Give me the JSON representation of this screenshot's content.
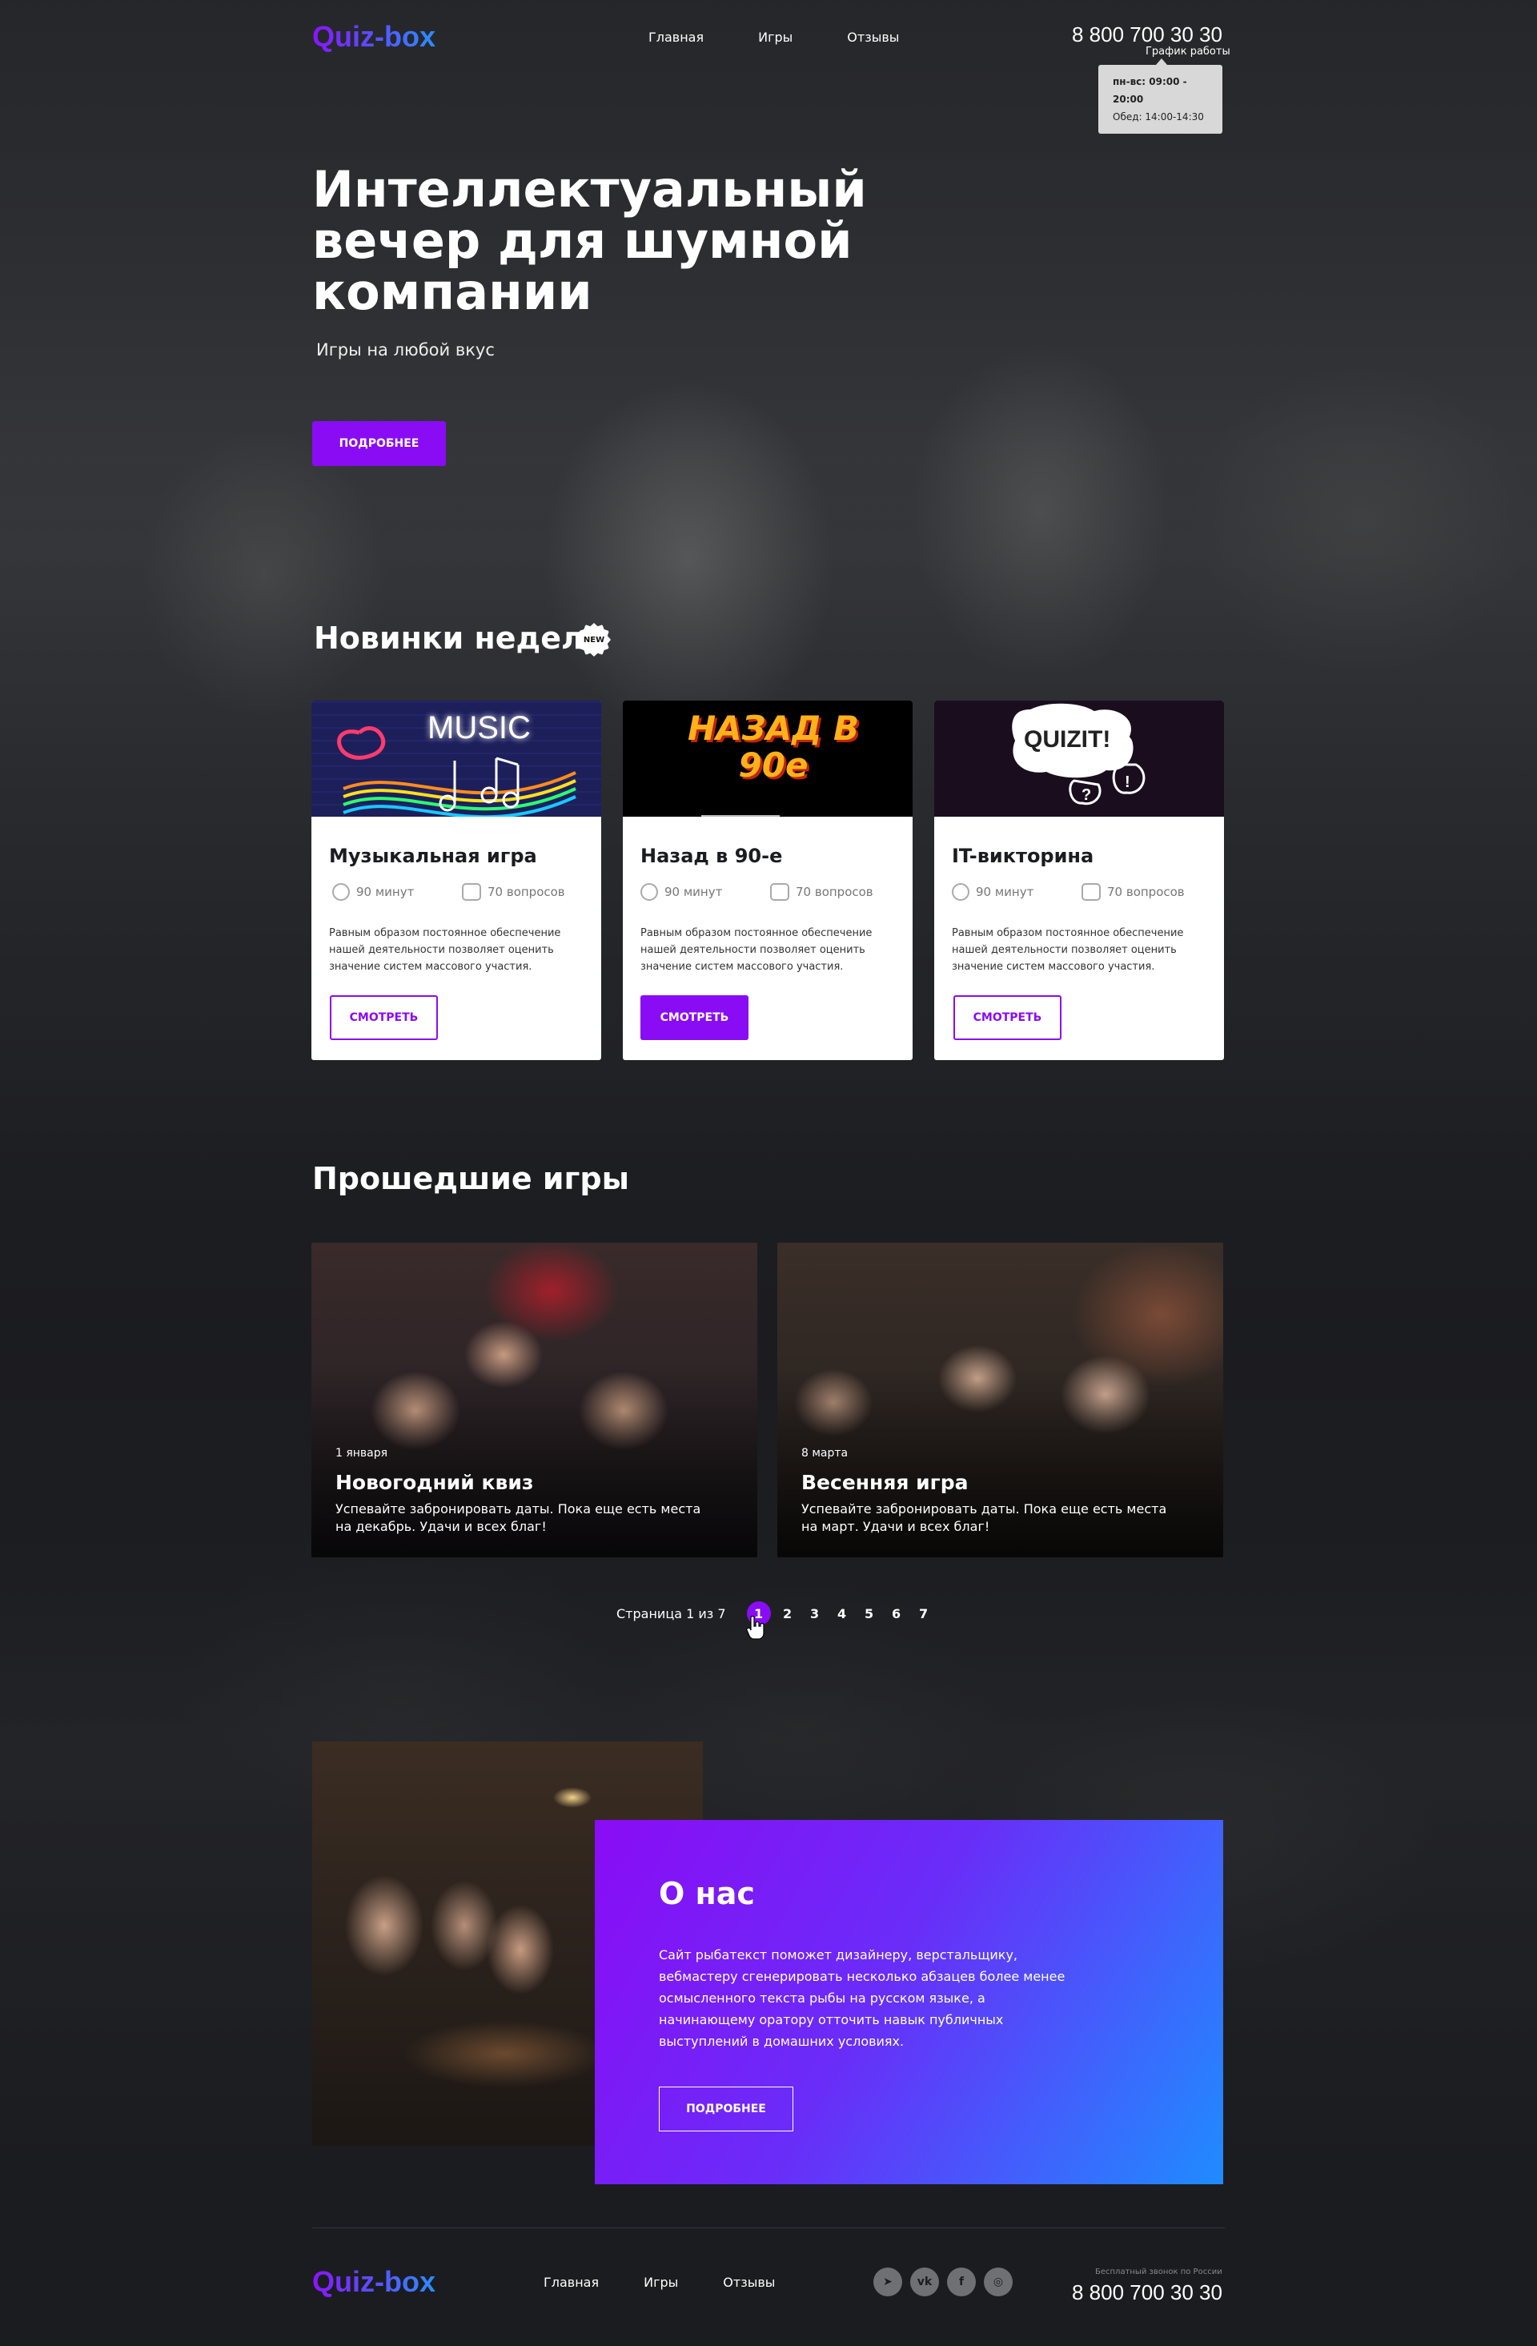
{
  "header": {
    "logo": "Quiz-box",
    "nav": [
      "Главная",
      "Игры",
      "Отзывы"
    ],
    "phone": "8 800 700 30 30",
    "schedule_label": "График работы",
    "schedule_days": "пн-вс: 09:00 - 20:00",
    "schedule_lunch": "Обед: 14:00-14:30"
  },
  "hero": {
    "title": "Интеллектуальный вечер для шумной компании",
    "subtitle": "Игры на любой вкус",
    "button": "ПОДРОБНЕЕ"
  },
  "new_week": {
    "title": "Новинки недели",
    "badge": "NEW",
    "cards": [
      {
        "image_text": "MUSIC",
        "title": "Музыкальная игра",
        "duration": "90 минут",
        "questions": "70 вопросов",
        "description": "Равным образом постоянное обеспечение нашей деятельности позволяет оценить значение систем массового участия.",
        "button": "СМОТРЕТЬ"
      },
      {
        "image_text": "НАЗАД В 90е",
        "title": "Назад в 90-е",
        "duration": "90 минут",
        "questions": "70 вопросов",
        "description": "Равным образом постоянное обеспечение нашей деятельности позволяет оценить значение систем массового участия.",
        "button": "СМОТРЕТЬ"
      },
      {
        "image_text": "QUIZIT!",
        "title": "IT-викторина",
        "duration": "90 минут",
        "questions": "70 вопросов",
        "description": "Равным образом постоянное обеспечение нашей деятельности позволяет оценить значение систем массового участия.",
        "button": "СМОТРЕТЬ"
      }
    ]
  },
  "past_games": {
    "title": "Прошедшие игры",
    "items": [
      {
        "date": "1 января",
        "title": "Новогодний квиз",
        "description": "Успевайте забронировать даты. Пока еще есть места на декабрь. Удачи и всех благ!"
      },
      {
        "date": "8 марта",
        "title": "Весенняя игра",
        "description": "Успевайте забронировать даты. Пока еще есть места на март. Удачи и всех благ!"
      }
    ],
    "pager_label": "Страница 1 из 7",
    "pages": [
      "1",
      "2",
      "3",
      "4",
      "5",
      "6",
      "7"
    ]
  },
  "about": {
    "title": "О нас",
    "text": "Сайт рыбатекст поможет дизайнеру, верстальщику, вебмастеру сгенерировать несколько абзацев более менее осмысленного текста рыбы на русском языке, а начинающему оратору отточить навык публичных выступлений в домашних условиях.",
    "button": "ПОДРОБНЕЕ"
  },
  "footer": {
    "logo": "Quiz-box",
    "nav": [
      "Главная",
      "Игры",
      "Отзывы"
    ],
    "social": [
      "telegram-icon",
      "vk-icon",
      "facebook-icon",
      "instagram-icon"
    ],
    "social_glyphs": [
      "➤",
      "vk",
      "f",
      "◎"
    ],
    "free_call": "Бесплатный звонок по России",
    "phone": "8 800 700 30 30"
  },
  "colors": {
    "accent": "#8a0cf5",
    "accent_blue": "#1f8cff",
    "background": "#1b1c20"
  }
}
